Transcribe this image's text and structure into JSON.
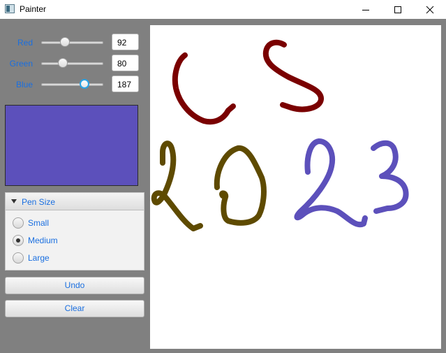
{
  "window": {
    "title": "Painter",
    "icon": "app-icon"
  },
  "colors": {
    "label": "#1a6fe0",
    "swatch": "#5c50bb",
    "stroke_cs": "#7a0000",
    "stroke_20": "#5e4a00",
    "stroke_23": "#5c50bb"
  },
  "sliders": [
    {
      "label": "Red",
      "value": "92",
      "max": 255
    },
    {
      "label": "Green",
      "value": "80",
      "max": 255
    },
    {
      "label": "Blue",
      "value": "187",
      "max": 255
    }
  ],
  "pen_size": {
    "title": "Pen Size",
    "options": [
      "Small",
      "Medium",
      "Large"
    ],
    "selected": "Medium"
  },
  "buttons": {
    "undo": "Undo",
    "clear": "Clear"
  }
}
